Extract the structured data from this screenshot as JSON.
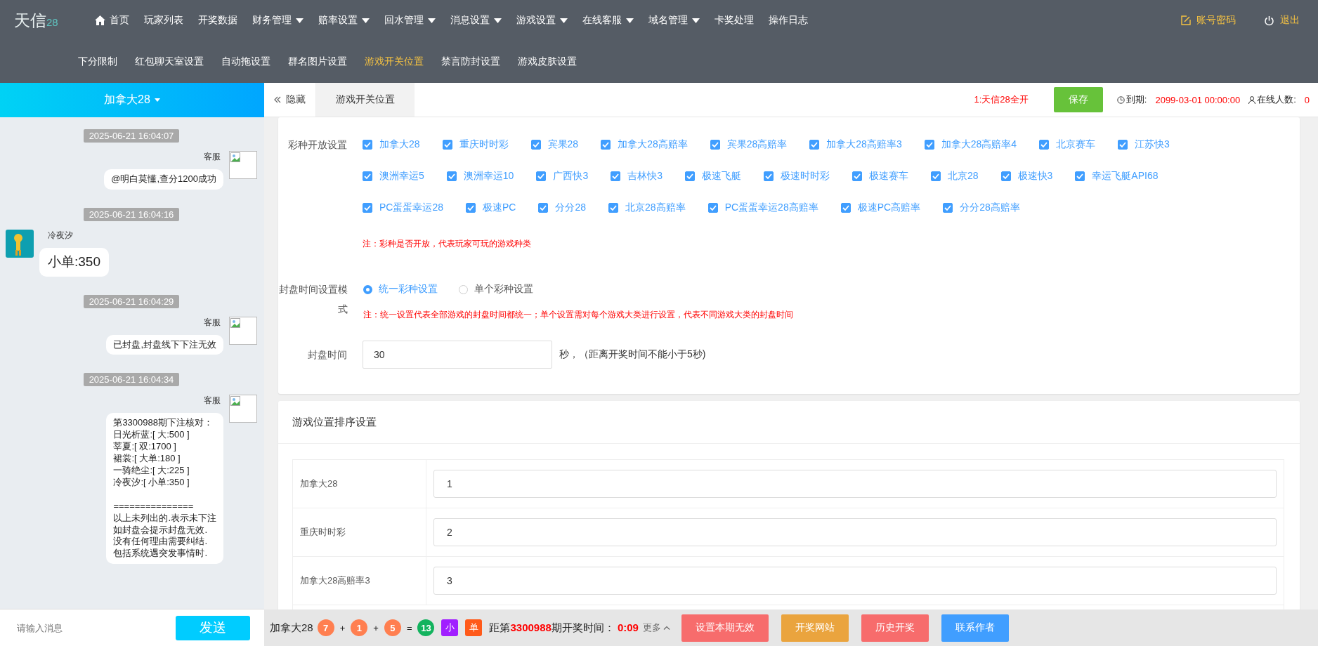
{
  "header": {
    "logo": {
      "name": "天信",
      "number": "28"
    },
    "nav": [
      {
        "label": "首页",
        "kind": "home"
      },
      {
        "label": "玩家列表",
        "kind": "plain"
      },
      {
        "label": "开奖数据",
        "kind": "plain"
      },
      {
        "label": "财务管理",
        "kind": "dropdown"
      },
      {
        "label": "赔率设置",
        "kind": "dropdown"
      },
      {
        "label": "回水管理",
        "kind": "dropdown"
      },
      {
        "label": "消息设置",
        "kind": "dropdown"
      },
      {
        "label": "游戏设置",
        "kind": "dropdown"
      },
      {
        "label": "在线客服",
        "kind": "dropdown"
      },
      {
        "label": "域名管理",
        "kind": "dropdown"
      },
      {
        "label": "卡奖处理",
        "kind": "plain"
      },
      {
        "label": "操作日志",
        "kind": "plain"
      }
    ],
    "account": "账号密码",
    "logout": "退出",
    "subnav": [
      {
        "label": "下分限制",
        "selected": false
      },
      {
        "label": "红包聊天室设置",
        "selected": false
      },
      {
        "label": "自动拖设置",
        "selected": false
      },
      {
        "label": "群名图片设置",
        "selected": false
      },
      {
        "label": "游戏开关位置",
        "selected": true
      },
      {
        "label": "禁言防封设置",
        "selected": false
      },
      {
        "label": "游戏皮肤设置",
        "selected": false
      }
    ]
  },
  "chat": {
    "room": "加拿大28",
    "items": [
      {
        "kind": "time",
        "text": "2025-06-21 16:04:07"
      },
      {
        "kind": "sent",
        "sender": "客服",
        "paragraphs": [
          [
            "@明白莫懂,查分1200成功"
          ]
        ]
      },
      {
        "kind": "time",
        "text": "2025-06-21 16:04:16"
      },
      {
        "kind": "received",
        "sender": "冷夜汐",
        "paragraphs": [
          [
            "小单:350"
          ]
        ]
      },
      {
        "kind": "time",
        "text": "2025-06-21 16:04:29"
      },
      {
        "kind": "sent",
        "sender": "客服",
        "paragraphs": [
          [
            "已封盘,封盘线下下注无效"
          ]
        ]
      },
      {
        "kind": "time",
        "text": "2025-06-21 16:04:34"
      },
      {
        "kind": "sent",
        "sender": "客服",
        "paragraphs": [
          [
            "第3300988期下注核对：",
            "日光析蓝:[ 大:500 ]",
            "莘夏:[ 双:1700 ]",
            "裙裳:[ 大单:180 ]",
            "一骑绝尘:[ 大:225 ]",
            "冷夜汐:[ 小单:350 ]"
          ],
          [
            "===============",
            "以上未列出的.表示未下注",
            "如封盘会提示封盘无效.",
            "没有任何理由需要纠结.",
            "包括系统遇突发事情时."
          ]
        ]
      }
    ],
    "input_placeholder": "请输入消息",
    "send": "发送"
  },
  "tabbar": {
    "hide": "隐藏",
    "tabs": [
      {
        "label": "游戏开关位置",
        "selected": true
      }
    ],
    "marquee": "1:天信28全开",
    "save": "保存",
    "expire_label": "到期:",
    "expire": "2099-03-01 00:00:00",
    "online_label": "在线人数:",
    "online": "0"
  },
  "open_settings": {
    "label": "彩种开放设置",
    "games": [
      {
        "name": "加拿大28",
        "checked": true
      },
      {
        "name": "重庆时时彩",
        "checked": true
      },
      {
        "name": "宾果28",
        "checked": true
      },
      {
        "name": "加拿大28高赔率",
        "checked": true
      },
      {
        "name": "宾果28高赔率",
        "checked": true
      },
      {
        "name": "加拿大28高赔率3",
        "checked": true
      },
      {
        "name": "加拿大28高赔率4",
        "checked": true
      },
      {
        "name": "北京赛车",
        "checked": true
      },
      {
        "name": "江苏快3",
        "checked": true
      },
      {
        "name": "澳洲幸运5",
        "checked": true
      },
      {
        "name": "澳洲幸运10",
        "checked": true
      },
      {
        "name": "广西快3",
        "checked": true
      },
      {
        "name": "吉林快3",
        "checked": true
      },
      {
        "name": "极速飞艇",
        "checked": true
      },
      {
        "name": "极速时时彩",
        "checked": true
      },
      {
        "name": "极速赛车",
        "checked": true
      },
      {
        "name": "北京28",
        "checked": true
      },
      {
        "name": "极速快3",
        "checked": true
      },
      {
        "name": "幸运飞艇API68",
        "checked": true
      },
      {
        "name": "PC蛋蛋幸运28",
        "checked": true
      },
      {
        "name": "极速PC",
        "checked": true
      },
      {
        "name": "分分28",
        "checked": true
      },
      {
        "name": "北京28高赔率",
        "checked": true
      },
      {
        "name": "PC蛋蛋幸运28高赔率",
        "checked": true
      },
      {
        "name": "极速PC高赔率",
        "checked": true
      },
      {
        "name": "分分28高赔率",
        "checked": true
      }
    ],
    "note": "注：彩种是否开放，代表玩家可玩的游戏种类",
    "mode_label": "封盘时间设置模式",
    "modes": [
      {
        "label": "统一彩种设置",
        "selected": true
      },
      {
        "label": "单个彩种设置",
        "selected": false
      }
    ],
    "mode_note": "注：统一设置代表全部游戏的封盘时间都统一；单个设置需对每个游戏大类进行设置，代表不同游戏大类的封盘时间",
    "time_label": "封盘时间",
    "time_value": "30",
    "time_hint": "秒，（距离开奖时间不能小于5秒)"
  },
  "order_settings": {
    "title": "游戏位置排序设置",
    "rows": [
      {
        "name": "加拿大28",
        "value": "1"
      },
      {
        "name": "重庆时时彩",
        "value": "2"
      },
      {
        "name": "加拿大28高赔率3",
        "value": "3"
      }
    ]
  },
  "draw_bar": {
    "game": "加拿大28",
    "balls": [
      {
        "text": "7",
        "color": "#ff7f50"
      },
      {
        "op": "+"
      },
      {
        "text": "1",
        "color": "#ff7f50"
      },
      {
        "op": "+"
      },
      {
        "text": "5",
        "color": "#ff7f50"
      },
      {
        "op": "="
      },
      {
        "text": "13",
        "color": "#13b35e"
      }
    ],
    "tags": [
      {
        "text": "小",
        "color": "#a11fff"
      },
      {
        "text": "单",
        "color": "#ff5a1a"
      }
    ],
    "countdown": [
      "距第",
      "3300988",
      "期开奖时间：",
      "0:09"
    ],
    "more": "更多",
    "buttons": [
      {
        "label": "设置本期无效",
        "color": "#f76c6c"
      },
      {
        "label": "开奖网站",
        "color": "#eaa43e"
      },
      {
        "label": "历史开奖",
        "color": "#f76c6c"
      },
      {
        "label": "联系作者",
        "color": "#409eff"
      }
    ]
  }
}
